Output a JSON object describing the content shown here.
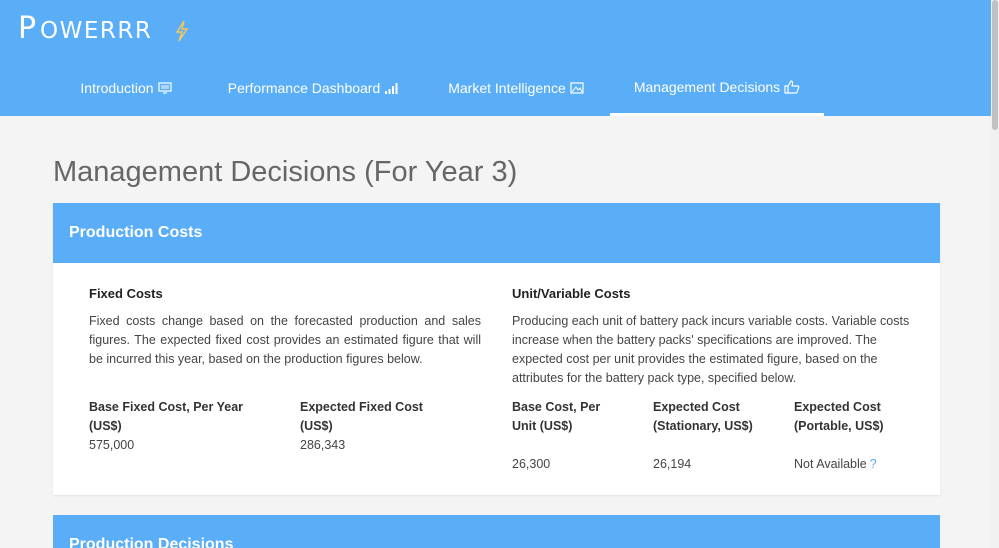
{
  "brand": {
    "name": "Powerrr",
    "logo_icon": "lightning-bolt-icon"
  },
  "nav": {
    "tabs": [
      {
        "label": "Introduction",
        "icon": "monitor-icon",
        "active": false
      },
      {
        "label": "Performance Dashboard",
        "icon": "signal-bars-icon",
        "active": false
      },
      {
        "label": "Market Intelligence",
        "icon": "picture-icon",
        "active": false
      },
      {
        "label": "Management Decisions",
        "icon": "thumbs-up-icon",
        "active": true
      }
    ]
  },
  "page": {
    "title": "Management Decisions (For Year 3)"
  },
  "production_costs": {
    "header": "Production Costs",
    "fixed": {
      "title": "Fixed Costs",
      "description": "Fixed costs change based on the forecasted production and sales figures. The expected fixed cost provides an estimated figure that will be incurred this year, based on the production figures below.",
      "fields": [
        {
          "label": "Base Fixed Cost, Per Year (US$)",
          "value": "575,000"
        },
        {
          "label": "Expected Fixed Cost (US$)",
          "value": "286,343"
        }
      ]
    },
    "variable": {
      "title": "Unit/Variable Costs",
      "description": "Producing each unit of battery pack incurs variable costs. Variable costs increase when the battery packs' specifications are improved. The expected cost per unit provides the estimated figure, based on the attributes for the battery pack type, specified below.",
      "fields": [
        {
          "label": "Base Cost, Per Unit (US$)",
          "value": "26,300"
        },
        {
          "label": "Expected Cost (Stationary, US$)",
          "value": "26,194"
        },
        {
          "label": "Expected Cost (Portable, US$)",
          "value": "Not Available",
          "help": "?"
        }
      ]
    }
  },
  "production_decisions": {
    "header": "Production Decisions"
  },
  "colors": {
    "accent": "#5aadf7",
    "background": "#f4f4f4"
  }
}
